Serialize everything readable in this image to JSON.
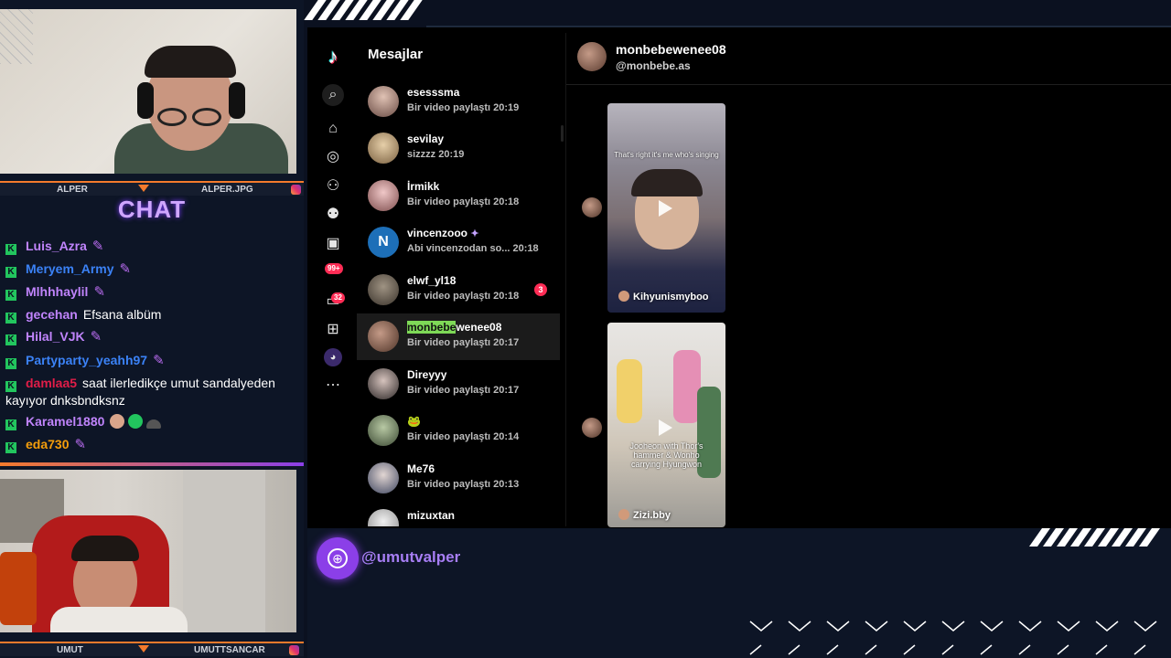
{
  "overlay": {
    "cam_top": {
      "left_name": "ALPER",
      "right_name": "ALPER.JPG"
    },
    "cam_bottom": {
      "left_name": "UMUT",
      "right_name": "UMUTTSANCAR"
    },
    "chat_title": "CHAT",
    "social_handle": "@umutvalper",
    "accent_color": "#8b3fe8",
    "chat": [
      {
        "user": "Luis_Azra",
        "color": "#c084fc",
        "msg": "",
        "badge": "sword-icon"
      },
      {
        "user": "Meryem_Army",
        "color": "#3b82f6",
        "msg": "",
        "badge": "sword-icon"
      },
      {
        "user": "Mlhhhaylil",
        "color": "#c084fc",
        "msg": "",
        "badge": "sword-icon"
      },
      {
        "user": "gecehan",
        "color": "#c084fc",
        "msg": "Efsana albüm"
      },
      {
        "user": "Hilal_VJK",
        "color": "#c084fc",
        "msg": "",
        "badge": "sword-icon"
      },
      {
        "user": "Partyparty_yeahh97",
        "color": "#3b82f6",
        "msg": "",
        "badge": "sword-icon"
      },
      {
        "user": "damlaa5",
        "color": "#e11d48",
        "msg": "saat ilerledikçe umut sandalyeden kayıyor dnksbndksnz"
      },
      {
        "user": "Karamel1880",
        "color": "#c084fc",
        "msg": "",
        "badge": "emote-icons"
      },
      {
        "user": "eda730",
        "color": "#f59e0b",
        "msg": "",
        "badge": "sword-icon"
      }
    ]
  },
  "tiktok": {
    "messages_title": "Mesajlar",
    "nav_badges": {
      "live": "99+",
      "inbox": "32"
    },
    "conversations": [
      {
        "name": "esesssma",
        "preview": "Bir video paylaştı 20:19"
      },
      {
        "name": "sevilay",
        "preview": "sizzzz 20:19"
      },
      {
        "name": "İrmikk",
        "preview": "Bir video paylaştı 20:18"
      },
      {
        "name": "vincenzooo",
        "preview": "Abi vincenzodan so...  20:18",
        "initial": "N"
      },
      {
        "name": "elwf_yl18",
        "preview": "Bir video paylaştı 20:18",
        "unread": "3"
      },
      {
        "name_hl": "monbebe",
        "name_rest": "wenee08",
        "preview": "Bir video paylaştı 20:17"
      },
      {
        "name": "Direyyy",
        "preview": "Bir video paylaştı 20:17"
      },
      {
        "name": "🐸",
        "preview": "Bir video paylaştı 20:14"
      },
      {
        "name": "Me76",
        "preview": "Bir video paylaştı 20:13"
      },
      {
        "name": "mizuxtan",
        "preview": ""
      }
    ],
    "active_chat": {
      "name": "monbebewenee08",
      "handle": "@monbebe.as"
    },
    "videos": [
      {
        "caption": "That's right it's me who's singing",
        "author": "Kihyunismyboo"
      },
      {
        "caption": "Jooheon with Thor's hammer & Wonho carrying Hyungwon",
        "author": "Zizi.bby"
      }
    ]
  }
}
